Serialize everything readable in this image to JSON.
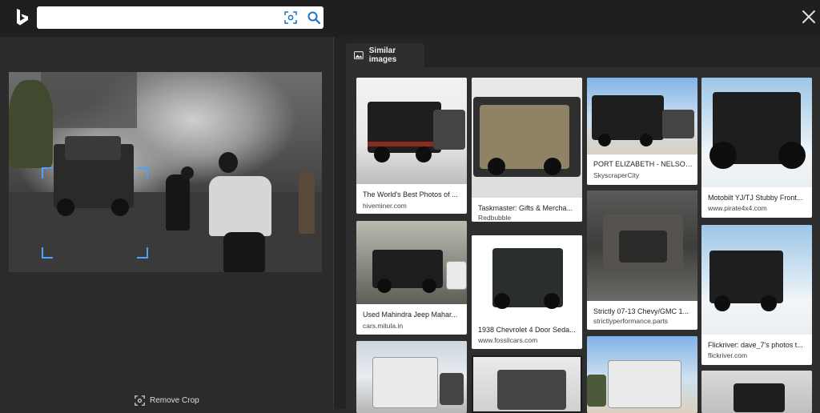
{
  "header": {
    "search": {
      "value": "",
      "placeholder": ""
    },
    "icons": {
      "logo": "bing-logo-icon",
      "visual_search": "visual-search-icon",
      "search": "search-icon",
      "close": "close-icon"
    }
  },
  "query_panel": {
    "remove_crop_label": "Remove Crop",
    "accent_color": "#4aa3ff"
  },
  "results": {
    "tab_label": "Similar images",
    "cards": [
      {
        "caption": "The World's Best Photos of ...",
        "source": "hiveminer.com"
      },
      {
        "caption": "Taskmaster: Gifts & Mercha...",
        "source": "Redbubble"
      },
      {
        "caption": "PORT ELIZABETH - NELSON...",
        "source": "SkyscraperCity"
      },
      {
        "caption": "Motobilt YJ/TJ Stubby Front...",
        "source": "www.pirate4x4.com"
      },
      {
        "caption": "Used Mahindra Jeep Mahar...",
        "source": "cars.mitula.in"
      },
      {
        "caption": "1938 Chevrolet 4 Door Seda...",
        "source": "www.fossilcars.com"
      },
      {
        "caption": "Strictly 07-13 Chevy/GMC 1...",
        "source": "strictlyperformance.parts"
      },
      {
        "caption": "Flickriver: dave_7's photos t...",
        "source": "flickriver.com"
      }
    ]
  }
}
